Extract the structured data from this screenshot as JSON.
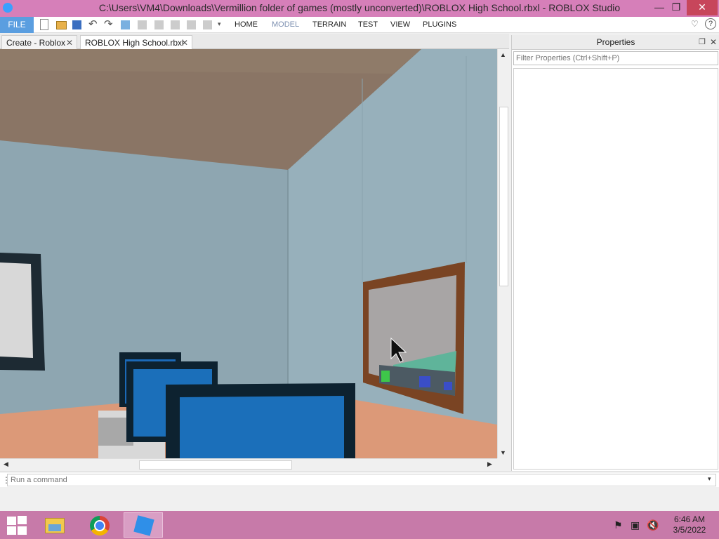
{
  "window": {
    "title": "C:\\Users\\VM4\\Downloads\\Vermillion folder of games (mostly unconverted)\\ROBLOX High School.rbxl - ROBLOX Studio",
    "minimize_glyph": "—",
    "maximize_glyph": "❐",
    "close_glyph": "✕"
  },
  "menu": {
    "file": "FILE",
    "tabs": [
      "HOME",
      "MODEL",
      "TERRAIN",
      "TEST",
      "VIEW",
      "PLUGINS"
    ],
    "active_tab": "MODEL",
    "help_glyph": "?"
  },
  "document_tabs": [
    {
      "label": "Create - Roblox",
      "active": false
    },
    {
      "label": "ROBLOX High School.rbxl",
      "active": true
    }
  ],
  "properties": {
    "title": "Properties",
    "filter_placeholder": "Filter Properties (Ctrl+Shift+P)"
  },
  "command_bar": {
    "placeholder": "Run a command"
  },
  "taskbar": {
    "apps": [
      "file-explorer-icon",
      "chrome-icon",
      "roblox-studio-icon"
    ],
    "time": "6:46 AM",
    "date": "3/5/2022"
  },
  "colors": {
    "titlebar": "#d67fb9",
    "taskbar": "#c77aa9",
    "file_button": "#5a9ee0",
    "close_button": "#c7465b"
  }
}
